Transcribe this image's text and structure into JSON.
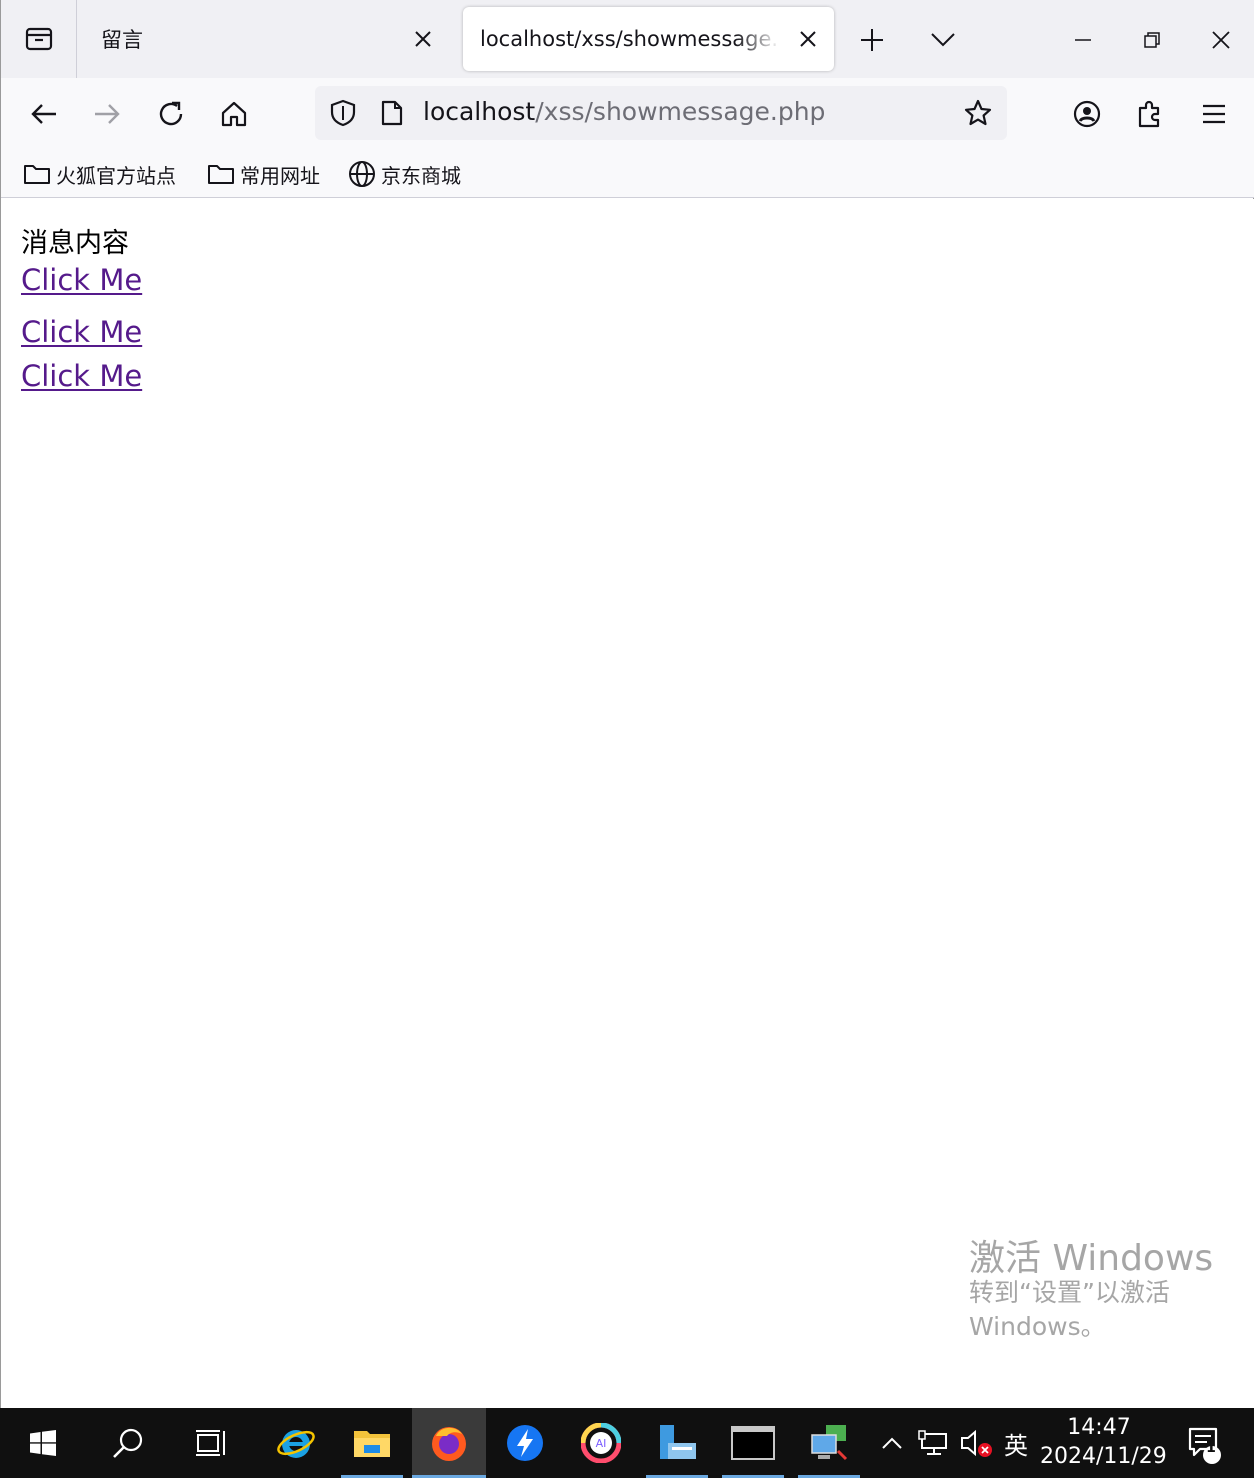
{
  "tabs": [
    {
      "title": "留言",
      "active": false
    },
    {
      "title": "localhost/xss/showmessage.php",
      "active": true
    }
  ],
  "url": {
    "host": "localhost",
    "path": "/xss/showmessage.php"
  },
  "bookmarks": [
    {
      "label": "火狐官方站点",
      "icon": "folder-icon"
    },
    {
      "label": "常用网址",
      "icon": "folder-icon"
    },
    {
      "label": "京东商城",
      "icon": "globe-icon"
    }
  ],
  "page": {
    "heading": "消息内容",
    "links": [
      "Click Me",
      "Click Me",
      "Click Me"
    ]
  },
  "watermark": {
    "line1": "激活 Windows",
    "line2": "转到“设置”以激活Windows。"
  },
  "taskbar": {
    "language": "英",
    "time": "14:47",
    "date": "2024/11/29",
    "notifications": "1"
  },
  "colors": {
    "link_visited": "#551a8b",
    "taskbar": "#101010",
    "tabstrip": "#f0f0f4"
  }
}
